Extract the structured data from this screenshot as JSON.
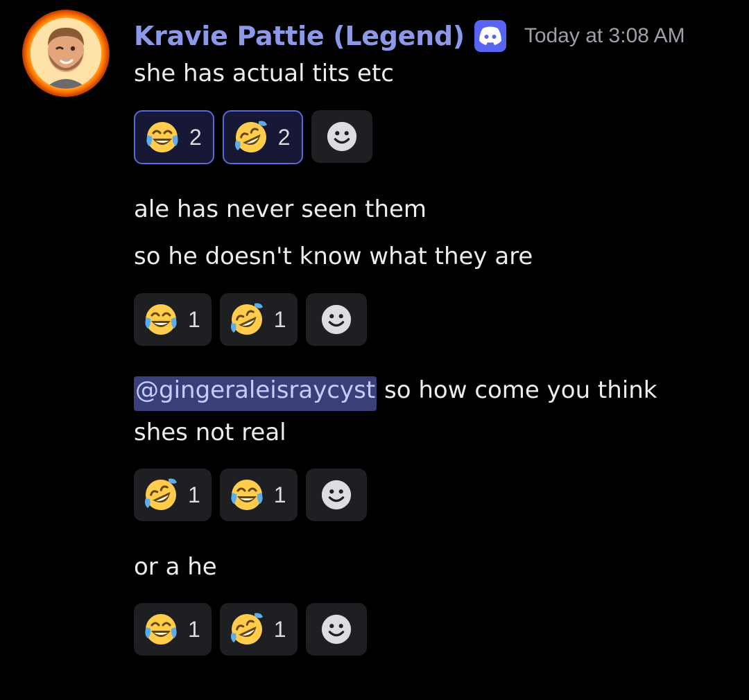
{
  "author": {
    "name": "Kravie Pattie (Legend)",
    "badge_icon": "discord-clyde-icon",
    "timestamp": "Today at 3:08 AM",
    "avatar_icon": "bearded-man-memoji-avatar"
  },
  "messages": [
    {
      "lines": [
        "she has actual tits etc"
      ],
      "reactions": [
        {
          "emoji": "joy-emoji",
          "count": "2",
          "me": true
        },
        {
          "emoji": "rofl-emoji",
          "count": "2",
          "me": true
        }
      ]
    },
    {
      "lines": [
        "ale has never seen them",
        "so he doesn't know what they are"
      ],
      "reactions": [
        {
          "emoji": "joy-emoji",
          "count": "1",
          "me": false
        },
        {
          "emoji": "rofl-emoji",
          "count": "1",
          "me": false
        }
      ]
    },
    {
      "mention": "@gingeraleisraycyst",
      "line1_rest": " so how come you think",
      "line2": "shes not real",
      "reactions": [
        {
          "emoji": "rofl-emoji",
          "count": "1",
          "me": false
        },
        {
          "emoji": "joy-emoji",
          "count": "1",
          "me": false
        }
      ]
    },
    {
      "lines": [
        "or a he"
      ],
      "reactions": [
        {
          "emoji": "joy-emoji",
          "count": "1",
          "me": false
        },
        {
          "emoji": "rofl-emoji",
          "count": "1",
          "me": false
        }
      ]
    }
  ],
  "colors": {
    "background": "#000000",
    "username": "#8c98e8",
    "mention_bg": "#3a3f7a",
    "reaction_bg": "#1e1f23",
    "reaction_me_border": "#5d69d6"
  }
}
